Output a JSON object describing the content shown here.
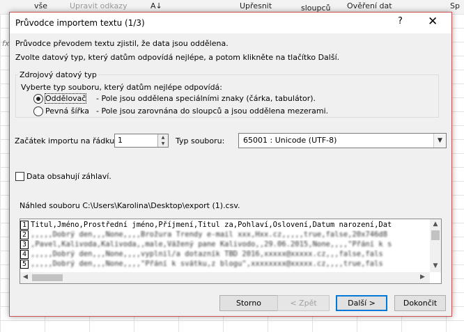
{
  "background": {
    "ribbon": {
      "item1": "vše",
      "item2": "Upravit odkazy",
      "item3": "A↓",
      "item4": "Upřesnit",
      "item5": "sloupců",
      "item6": "Ověření dat",
      "item7": "Sp"
    },
    "fx": "fx"
  },
  "dialog": {
    "title": "Průvodce importem textu (1/3)",
    "help": "?",
    "close": "✕",
    "intro1": "Průvodce převodem textu zjistil, že data jsou oddělena.",
    "intro2": "Zvolte datový typ, který datům odpovídá nejlépe, a potom klikněte na tlačítko Další.",
    "group": {
      "legend": "Zdrojový datový typ",
      "prompt": "Vyberte typ souboru, který datům nejlépe odpovídá:",
      "option1": {
        "label": "Oddělovač",
        "desc": "- Pole jsou oddělena speciálními znaky (čárka, tabulátor).",
        "selected": true
      },
      "option2": {
        "label": "Pevná šířka",
        "desc": "- Pole jsou zarovnána do sloupců a jsou oddělena mezerami.",
        "selected": false
      }
    },
    "start_row_label": "Začátek importu na řádku:",
    "start_row_value": "1",
    "file_type_label": "Typ souboru:",
    "file_type_value": "65001 : Unicode (UTF-8)",
    "headers_label": "Data obsahují záhlaví.",
    "preview_label": "Náhled souboru C:\\Users\\Karolina\\Desktop\\export (1).csv.",
    "preview_lines": [
      {
        "no": "1",
        "text": "Titul,Jméno,Prostřední jméno,Příjmení,Titul za,Pohlaví,Oslovení,Datum narození,Dat"
      },
      {
        "no": "2",
        "text": ",,,,,Dobrý den,,,None,,,,Brožura Trendy e-mail xxx,Hxx.cz,,,,,true,false,20x746d8"
      },
      {
        "no": "3",
        "text": ",Pavel,Kalivoda,Kalivoda,,male,Vážený pane Kalivodo,,29.06.2015,None,,,,\"Přání k s"
      },
      {
        "no": "4",
        "text": ",,,,,Dobrý den,,,None,,,,vyplnil/a dotazník TBD 2016,xxxxx@xxxxx.cz,,,false,fals"
      },
      {
        "no": "5",
        "text": ",,,,,Dobrý den,,,None,,,,\"Přání k svátku,z blogu\",xxxxxxxx@xxxxx.cz,,,,true,fals"
      }
    ],
    "buttons": {
      "cancel": "Storno",
      "back": "< Zpět",
      "next": "Další >",
      "finish": "Dokončit"
    }
  }
}
